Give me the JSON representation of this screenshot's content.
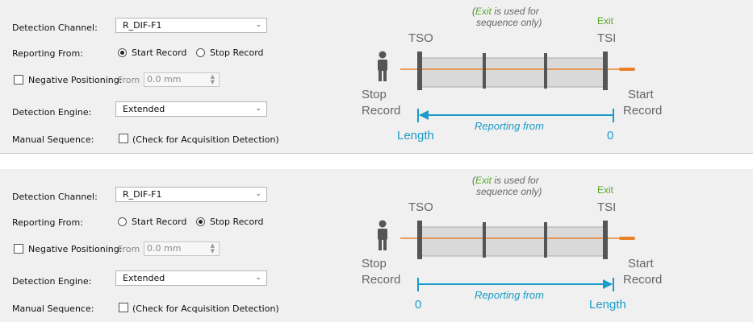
{
  "panels": [
    {
      "detection_channel": {
        "label": "Detection Channel:",
        "value": "R_DIF-F1"
      },
      "reporting_from": {
        "label": "Reporting From:",
        "options": [
          "Start Record",
          "Stop Record"
        ],
        "selected": "Start Record"
      },
      "negative_positioning": {
        "label": "Negative Positioning:",
        "checked": false,
        "from_label": "From",
        "value": "0.0 mm"
      },
      "detection_engine": {
        "label": "Detection Engine:",
        "value": "Extended"
      },
      "manual_sequence": {
        "label": "Manual Sequence:",
        "checkbox_label": "(Check for Acquisition Detection)",
        "checked": false
      },
      "diagram": {
        "exit_note_part1": "(",
        "exit_note_em": "Exit",
        "exit_note_part2": " is used for",
        "exit_note_line2": "sequence only)",
        "exit_label": "Exit",
        "tso": "TSO",
        "tsi": "TSI",
        "left_label_1": "Stop",
        "left_label_2": "Record",
        "right_label_1": "Start",
        "right_label_2": "Record",
        "reporting_from": "Reporting from",
        "left_value": "Length",
        "right_value": "0",
        "arrow_direction": "left"
      }
    },
    {
      "detection_channel": {
        "label": "Detection Channel:",
        "value": "R_DIF-F1"
      },
      "reporting_from": {
        "label": "Reporting From:",
        "options": [
          "Start Record",
          "Stop Record"
        ],
        "selected": "Stop Record"
      },
      "negative_positioning": {
        "label": "Negative Positioning:",
        "checked": false,
        "from_label": "From",
        "value": "0.0 mm"
      },
      "detection_engine": {
        "label": "Detection Engine:",
        "value": "Extended"
      },
      "manual_sequence": {
        "label": "Manual Sequence:",
        "checkbox_label": "(Check for Acquisition Detection)",
        "checked": false
      },
      "diagram": {
        "exit_note_part1": "(",
        "exit_note_em": "Exit",
        "exit_note_part2": " is used for",
        "exit_note_line2": "sequence only)",
        "exit_label": "Exit",
        "tso": "TSO",
        "tsi": "TSI",
        "left_label_1": "Stop",
        "left_label_2": "Record",
        "right_label_1": "Start",
        "right_label_2": "Record",
        "reporting_from": "Reporting from",
        "left_value": "0",
        "right_value": "Length",
        "arrow_direction": "right"
      }
    }
  ],
  "colors": {
    "accent_blue": "#1a9bc9",
    "exit_green": "#58a82e",
    "orange_line": "#e8822a",
    "gray_text": "#666666",
    "dark_bar": "#555555"
  },
  "icons": {
    "person": "person-icon"
  }
}
